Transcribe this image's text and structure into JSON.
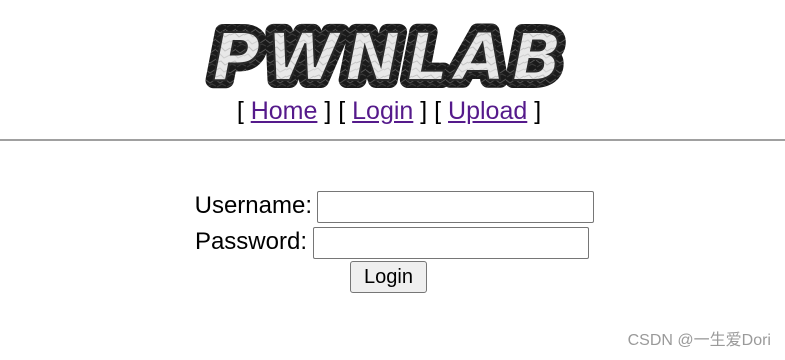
{
  "logo": {
    "text": "PWNLAB"
  },
  "nav": {
    "open_bracket": "[ ",
    "separator": " ] [ ",
    "close_bracket": " ]",
    "items": [
      {
        "label": "Home"
      },
      {
        "label": "Login"
      },
      {
        "label": "Upload"
      }
    ]
  },
  "form": {
    "username_label": "Username:",
    "password_label": "Password:",
    "username_value": "",
    "password_value": "",
    "submit_label": "Login"
  },
  "watermark": "CSDN @一生爱Dori"
}
